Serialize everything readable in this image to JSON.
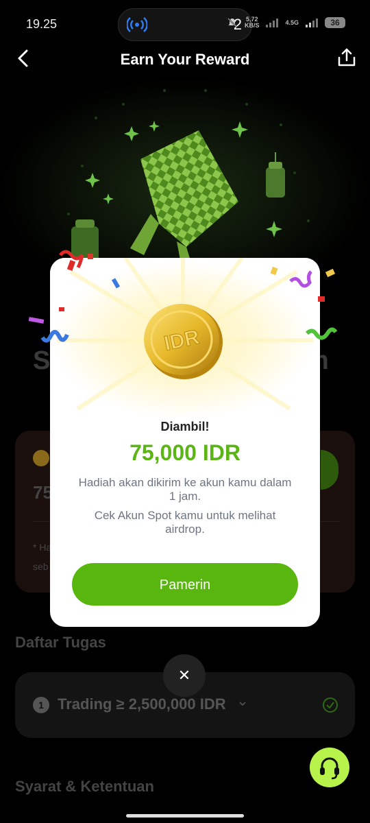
{
  "status_bar": {
    "time": "19.25",
    "pill_count": "2",
    "speed_top": "5,72",
    "speed_bottom": "KB/S",
    "network": "4.5G",
    "battery": "36"
  },
  "nav": {
    "title": "Earn Your Reward"
  },
  "background": {
    "heading_left": "S",
    "heading_right": "m",
    "amount_partial": "75",
    "note_line1": "* Ha",
    "note_line2": "seb",
    "tasks_title": "Daftar Tugas",
    "task": {
      "number": "1",
      "label": "Trading ≥ 2,500,000 IDR"
    },
    "terms_title": "Syarat & Ketentuan"
  },
  "modal": {
    "coin_text": "IDR",
    "claimed_label": "Diambil!",
    "amount": "75,000 IDR",
    "message_1": "Hadiah akan dikirim ke akun kamu dalam 1 jam.",
    "message_2": "Cek Akun Spot kamu untuk melihat airdrop.",
    "button_label": "Pamerin"
  },
  "close_symbol": "✕",
  "colors": {
    "accent_green": "#58b60e",
    "amount_green": "#5bb515",
    "support_lime": "#b7f34a"
  }
}
